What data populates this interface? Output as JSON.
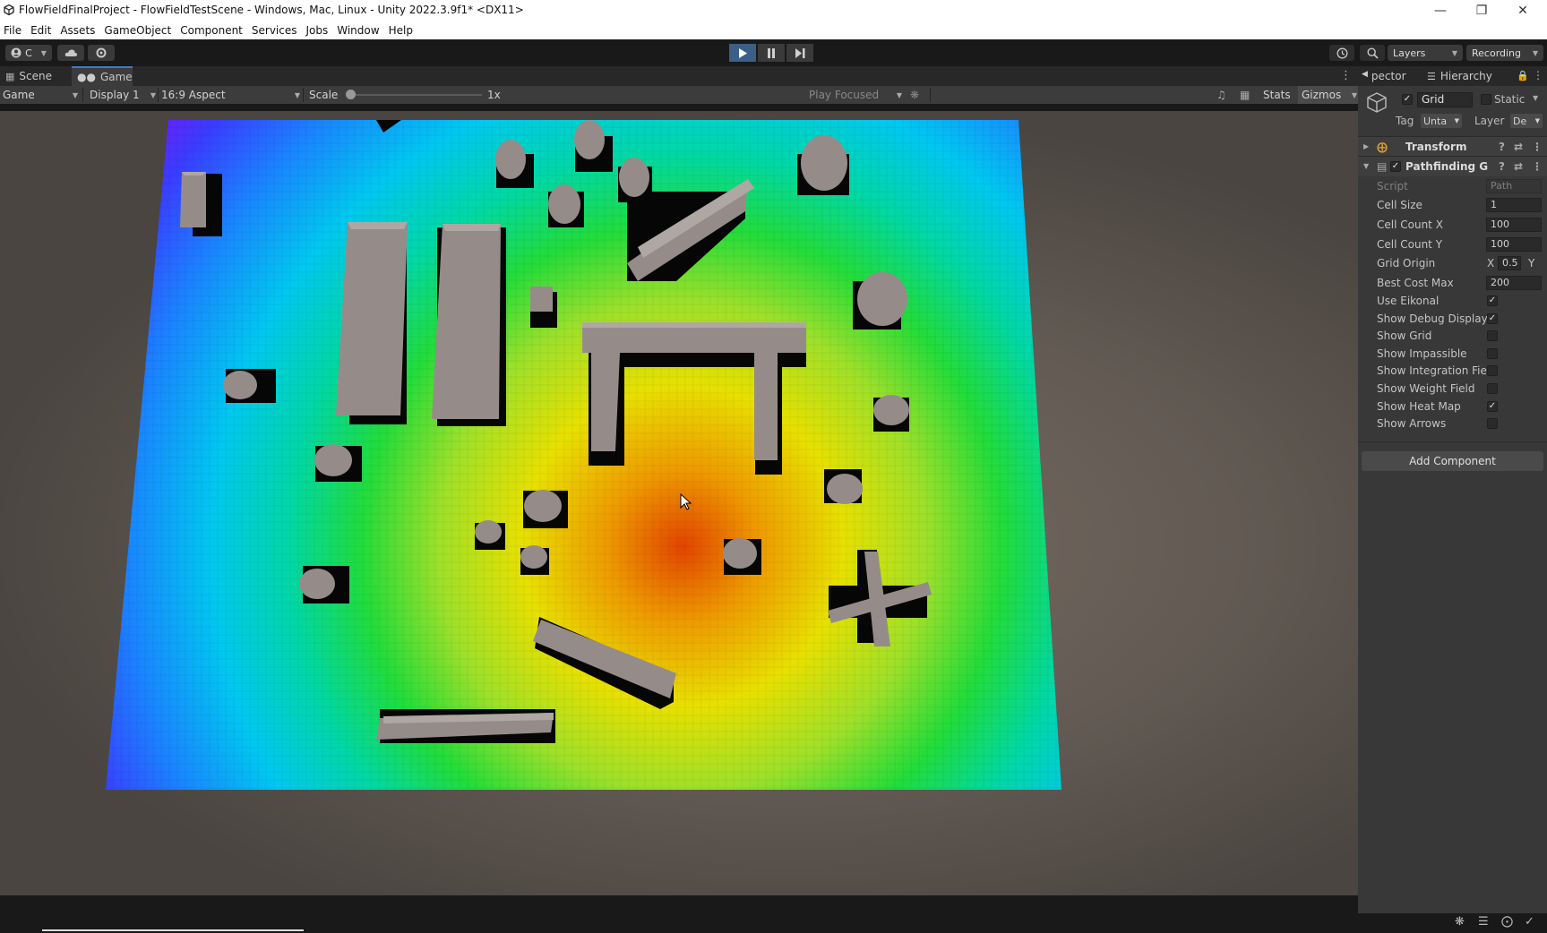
{
  "window": {
    "title": "FlowFieldFinalProject - FlowFieldTestScene - Windows, Mac, Linux - Unity 2022.3.9f1* <DX11>"
  },
  "menu": {
    "items": [
      {
        "label": "File"
      },
      {
        "label": "Edit"
      },
      {
        "label": "Assets"
      },
      {
        "label": "GameObject"
      },
      {
        "label": "Component"
      },
      {
        "label": "Services"
      },
      {
        "label": "Jobs"
      },
      {
        "label": "Window"
      },
      {
        "label": "Help"
      }
    ]
  },
  "toolbar": {
    "account_label": "C",
    "layers_label": "Layers",
    "layout_label": "Recording"
  },
  "tabs": {
    "scene": "Scene",
    "game": "Game"
  },
  "gamebar": {
    "mode": "Game",
    "display": "Display 1",
    "aspect": "16:9 Aspect",
    "scale_label": "Scale",
    "scale_value": "1x",
    "play_mode": "Play Focused",
    "stats": "Stats",
    "gizmos": "Gizmos"
  },
  "inspector": {
    "tab_inspector": "pector",
    "tab_hierarchy": "Hierarchy",
    "object_name": "Grid",
    "static_label": "Static",
    "tag_label": "Tag",
    "tag_value": "Unta",
    "layer_label": "Layer",
    "layer_value": "De",
    "transform_title": "Transform",
    "component_title": "Pathfinding G",
    "script_label": "Script",
    "script_value": "Path",
    "cell_size_label": "Cell Size",
    "cell_size_value": "1",
    "cell_count_x_label": "Cell Count X",
    "cell_count_x_value": "100",
    "cell_count_y_label": "Cell Count Y",
    "cell_count_y_value": "100",
    "grid_origin_label": "Grid Origin",
    "grid_origin_x_label": "X",
    "grid_origin_x_value": "0.5",
    "grid_origin_y_label": "Y",
    "best_cost_max_label": "Best Cost Max",
    "best_cost_max_value": "200",
    "toggles": [
      {
        "label": "Use Eikonal",
        "checked": true
      },
      {
        "label": "Show Debug Display",
        "checked": true
      },
      {
        "label": "Show Grid",
        "checked": false
      },
      {
        "label": "Show Impassible",
        "checked": false
      },
      {
        "label": "Show Integration Fie",
        "checked": false
      },
      {
        "label": "Show Weight Field",
        "checked": false
      },
      {
        "label": "Show Heat Map",
        "checked": true
      },
      {
        "label": "Show Arrows",
        "checked": false
      }
    ],
    "add_component": "Add Component"
  },
  "colors": {
    "accent": "#3c7bd1",
    "play_active": "#3c5f88",
    "heat_hot": "#e04000",
    "heat_mid": "#e6e600",
    "heat_green": "#22dd33",
    "heat_cyan": "#00c8f0",
    "heat_blue": "#2a4cff",
    "heat_magenta": "#d000e8",
    "obstacle": "#958c8a"
  },
  "icons": {
    "unity_logo": "unity-logo-icon",
    "minimize": "minimize-icon",
    "maximize": "maximize-icon",
    "close": "close-icon",
    "cursor": "mouse-cursor-icon"
  }
}
